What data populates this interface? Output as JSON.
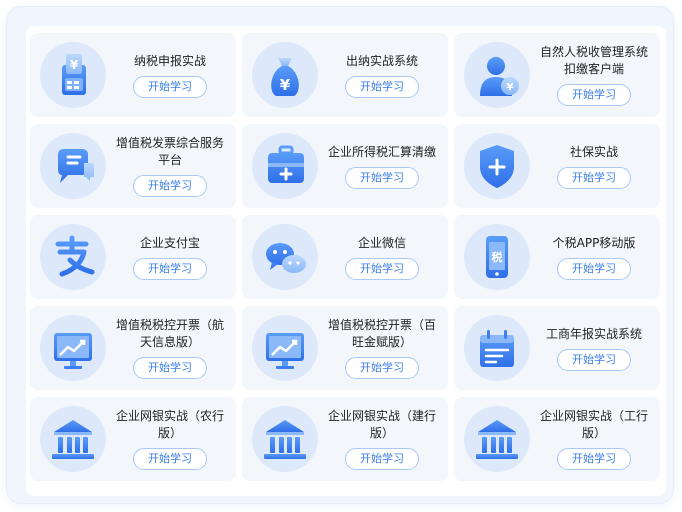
{
  "courses": [
    {
      "title": "纳税申报实战",
      "button": "开始学习",
      "icon": "tax-declaration-icon"
    },
    {
      "title": "出纳实战系统",
      "button": "开始学习",
      "icon": "money-bag-icon"
    },
    {
      "title": "自然人税收管理系统扣缴客户端",
      "button": "开始学习",
      "icon": "person-tax-icon"
    },
    {
      "title": "增值税发票综合服务平台",
      "button": "开始学习",
      "icon": "chat-bubble-icon"
    },
    {
      "title": "企业所得税汇算清缴",
      "button": "开始学习",
      "icon": "toolbox-icon"
    },
    {
      "title": "社保实战",
      "button": "开始学习",
      "icon": "shield-plus-icon"
    },
    {
      "title": "企业支付宝",
      "button": "开始学习",
      "icon": "alipay-icon"
    },
    {
      "title": "企业微信",
      "button": "开始学习",
      "icon": "wechat-icon"
    },
    {
      "title": "个税APP移动版",
      "button": "开始学习",
      "icon": "phone-tax-icon"
    },
    {
      "title": "增值税税控开票（航天信息版）",
      "button": "开始学习",
      "icon": "chart-monitor-icon"
    },
    {
      "title": "增值税税控开票（百旺金赋版）",
      "button": "开始学习",
      "icon": "chart-monitor-icon"
    },
    {
      "title": "工商年报实战系统",
      "button": "开始学习",
      "icon": "calendar-icon"
    },
    {
      "title": "企业网银实战（农行版）",
      "button": "开始学习",
      "icon": "bank-icon"
    },
    {
      "title": "企业网银实战（建行版）",
      "button": "开始学习",
      "icon": "bank-icon"
    },
    {
      "title": "企业网银实战（工行版）",
      "button": "开始学习",
      "icon": "bank-icon"
    }
  ],
  "colors": {
    "accent": "#3a7ee6",
    "icon_dark": "#3d7ef0",
    "icon_light": "#9cc4fb",
    "card_bg": "#f3f6fb",
    "icon_circle_bg": "#dde9fb"
  }
}
